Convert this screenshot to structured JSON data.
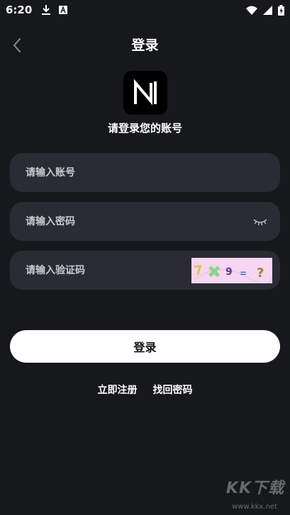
{
  "status_bar": {
    "time": "6:20",
    "icons": [
      "download-icon",
      "a-badge-icon",
      "wifi-icon",
      "signal-icon",
      "battery-icon"
    ]
  },
  "header": {
    "title": "登录"
  },
  "logo": {
    "letter": "N"
  },
  "subtitle": "请登录您的账号",
  "form": {
    "account_placeholder": "请输入账号",
    "password_placeholder": "请输入密码",
    "captcha_placeholder": "请输入验证码",
    "captcha_text": "7 ✖9 = ?"
  },
  "login_button": "登录",
  "links": {
    "register": "立即注册",
    "forgot": "找回密码"
  },
  "watermark": {
    "brand": "KK下载",
    "url": "www.kkx.net"
  },
  "colors": {
    "background": "#17181c",
    "field_bg": "#2a2c34",
    "button_bg": "#ffffff",
    "captcha_bg": "#f6d6f0"
  }
}
